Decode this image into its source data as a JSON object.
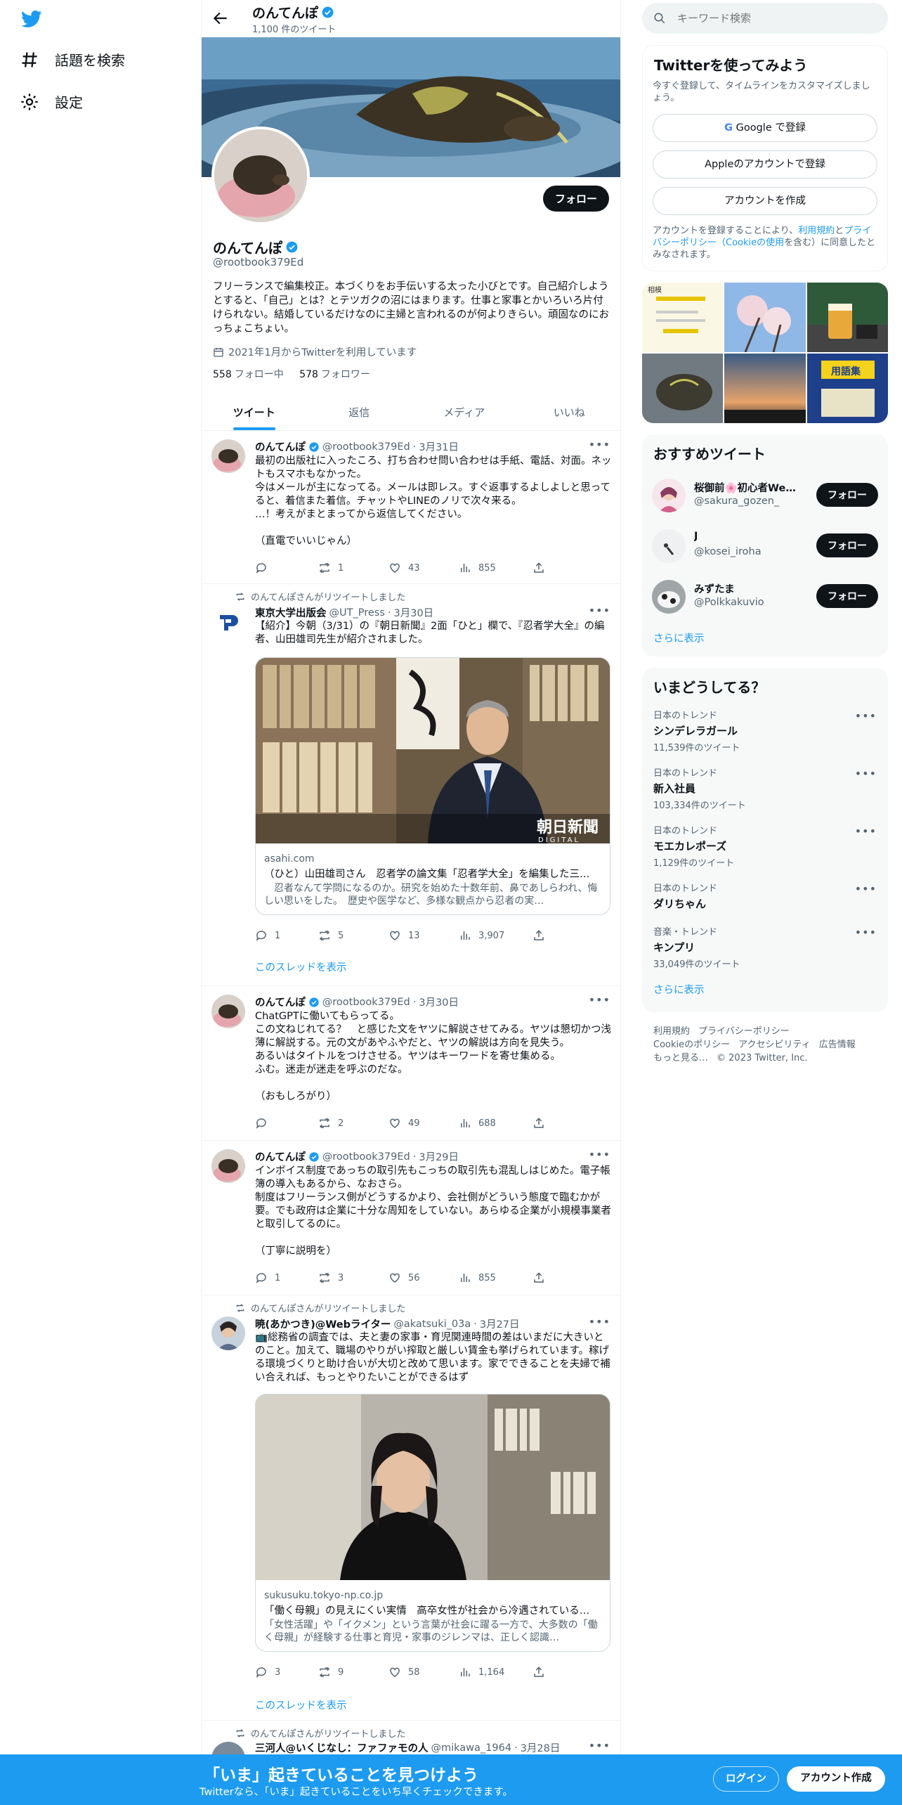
{
  "nav": {
    "items": [
      {
        "label": "話題を検索",
        "icon": "hashtag-icon"
      },
      {
        "label": "設定",
        "icon": "gear-icon"
      }
    ]
  },
  "profile": {
    "name": "のんてんぽ",
    "tweet_count": "1,100 件のツイート",
    "handle": "@rootbook379Ed",
    "follow_label": "フォロー",
    "bio": "フリーランスで編集校正。本づくりをお手伝いする太った小びとです。自己紹介しようとすると、「自己」とは？とテツガクの沼にはまります。仕事と家事とかいろいろ片付けられない。結婚しているだけなのに主婦と言われるのが何よりきらい。頑固なのにおっちょこちょい。",
    "joined": "2021年1月からTwitterを利用しています",
    "following_count": "558",
    "following_label": "フォロー中",
    "followers_count": "578",
    "followers_label": "フォロワー"
  },
  "tabs": [
    "ツイート",
    "返信",
    "メディア",
    "いいね"
  ],
  "tweets": [
    {
      "name": "のんてんぽ",
      "handle": "@rootbook379Ed",
      "date": "3月31日",
      "text": "最初の出版社に入ったころ、打ち合わせ問い合わせは手紙、電話、対面。ネットもスマホもなかった。\n今はメールが主になってる。メールは即レス。すぐ返事するよしよしと思ってると、着信また着信。チャットやLINEのノリで次々来る。\n…！考えがまとまってから返信してください。\n\n（直電でいいじゃん）",
      "replies": "",
      "retweets": "1",
      "likes": "43",
      "views": "855"
    },
    {
      "retweeted_by": "のんてんぽさんがリツイートしました",
      "name": "東京大学出版会",
      "handle": "@UT_Press",
      "date": "3月30日",
      "text": "【紹介】今朝（3/31）の『朝日新聞』2面「ひと」欄で、『忍者学大全』の編者、山田雄司先生が紹介されました。",
      "card_domain": "asahi.com",
      "card_title": "（ひと）山田雄司さん　忍者学の論文集「忍者学大全」を編集した三…",
      "card_desc": "　忍者なんて学問になるのか。研究を始めた十数年前、鼻であしらわれ、悔しい思いをした。　歴史や医学など、多様な観点から忍者の実…",
      "card_watermark": "朝日新聞",
      "card_watermark_sub": "DIGITAL",
      "replies": "1",
      "retweets": "5",
      "likes": "13",
      "views": "3,907",
      "thread_label": "このスレッドを表示"
    },
    {
      "name": "のんてんぽ",
      "handle": "@rootbook379Ed",
      "date": "3月30日",
      "text": "ChatGPTに働いてもらってる。\nこの文ねじれてる？　と感じた文をヤツに解説させてみる。ヤツは懇切かつ浅薄に解説する。元の文があやふやだと、ヤツの解説は方向を見失う。\nあるいはタイトルをつけさせる。ヤツはキーワードを寄せ集める。\nふむ。迷走が迷走を呼ぶのだな。\n\n（おもしろがり）",
      "replies": "",
      "retweets": "2",
      "likes": "49",
      "views": "688"
    },
    {
      "name": "のんてんぽ",
      "handle": "@rootbook379Ed",
      "date": "3月29日",
      "text": "インボイス制度であっちの取引先もこっちの取引先も混乱しはじめた。電子帳簿の導入もあるから、なおさら。\n制度はフリーランス側がどうするかより、会社側がどういう態度で臨むかが要。でも政府は企業に十分な周知をしていない。あらゆる企業が小規模事業者と取引してるのに。\n\n（丁寧に説明を）",
      "replies": "1",
      "retweets": "3",
      "likes": "56",
      "views": "855"
    },
    {
      "retweeted_by": "のんてんぽさんがリツイートしました",
      "name": "暁(あかつき)@Webライター",
      "handle": "@akatsuki_03a",
      "date": "3月27日",
      "text": "📺総務省の調査では、夫と妻の家事・育児関連時間の差はいまだに大きいとのこと。加えて、職場のやりがい搾取と厳しい賃金も挙げられています。稼げる環境づくりと助け合いが大切と改めて思います。家でできることを夫婦で補い合えれば、もっとやりたいことができるはず",
      "card_domain": "sukusuku.tokyo-np.co.jp",
      "card_title": "「働く母親」の見えにくい実情　高卒女性が社会から冷遇されている…",
      "card_desc": "「女性活躍」や「イクメン」という言葉が社会に躍る一方で、大多数の「働く母親」が経験する仕事と育児・家事のジレンマは、正しく認識…",
      "replies": "3",
      "retweets": "9",
      "likes": "58",
      "views": "1,164",
      "thread_label": "このスレッドを表示"
    },
    {
      "retweeted_by": "のんてんぽさんがリツイートしました",
      "name": "三河人@いくじなし：ファファモの人",
      "handle": "@mikawa_1964",
      "date": "3月28日"
    }
  ],
  "sidebar": {
    "search_placeholder": "キーワード検索",
    "signup": {
      "title": "Twitterを使ってみよう",
      "subtitle": "今すぐ登録して、タイムラインをカスタマイズしましょう。",
      "google": "Google で登録",
      "apple": "Appleのアカウントで登録",
      "create": "アカウントを作成",
      "legal_pre": "アカウントを登録することにより、",
      "legal_terms": "利用規約",
      "legal_and": "と",
      "legal_privacy": "プライバシーポリシー（Cookieの使用",
      "legal_post": "を含む）に同意したとみなされます。"
    },
    "media_grid": {
      "tile1_text": "相模",
      "tile6_text": "用語集"
    },
    "recommend": {
      "title": "おすすめツイート",
      "follow_label": "フォロー",
      "users": [
        {
          "name": "桜御前🌸初心者Web...",
          "handle": "@sakura_gozen_"
        },
        {
          "name": "J",
          "handle": "@kosei_iroha"
        },
        {
          "name": "みずたま",
          "handle": "@Polkkakuvio"
        }
      ],
      "more": "さらに表示"
    },
    "trends": {
      "title": "いまどうしてる？",
      "items": [
        {
          "context": "日本のトレンド",
          "topic": "シンデレラガール",
          "count": "11,539件のツイート"
        },
        {
          "context": "日本のトレンド",
          "topic": "新入社員",
          "count": "103,334件のツイート"
        },
        {
          "context": "日本のトレンド",
          "topic": "モエカレポーズ",
          "count": "1,129件のツイート"
        },
        {
          "context": "日本のトレンド",
          "topic": "ダリちゃん",
          "count": ""
        },
        {
          "context": "音楽・トレンド",
          "topic": "キンプリ",
          "count": "33,049件のツイート"
        }
      ],
      "more": "さらに表示"
    },
    "footer": {
      "terms": "利用規約",
      "privacy": "プライバシーポリシー",
      "cookie": "Cookieのポリシー",
      "accessibility": "アクセシビリティ",
      "ads": "広告情報",
      "more": "もっと見る…",
      "copyright": "© 2023 Twitter, Inc."
    }
  },
  "bottombar": {
    "title": "「いま」起きていることを見つけよう",
    "subtitle": "Twitterなら、「いま」起きていることをいち早くチェックできます。",
    "login": "ログイン",
    "signup": "アカウント作成"
  },
  "colors": {
    "accent": "#1d9bf0",
    "text": "#0f1419",
    "muted": "#536471"
  }
}
